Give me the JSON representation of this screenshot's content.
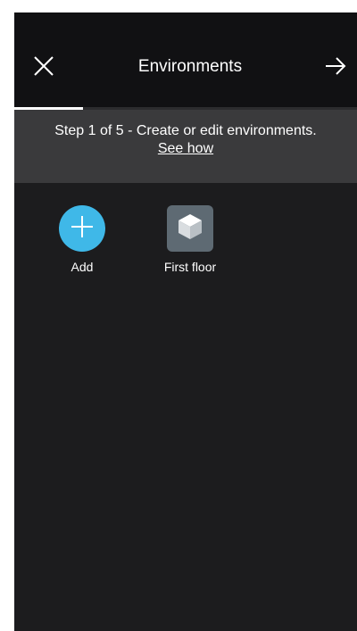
{
  "header": {
    "title": "Environments",
    "close_icon": "close-icon",
    "next_icon": "arrow-right-icon"
  },
  "progress": {
    "current_step": 1,
    "total_steps": 5,
    "fraction": 0.2
  },
  "banner": {
    "text": "Step 1 of 5 - Create or edit environments.",
    "link_label": "See how"
  },
  "environments": {
    "add": {
      "label": "Add",
      "icon": "plus-icon",
      "color": "#3fb8e8"
    },
    "items": [
      {
        "label": "First floor",
        "icon": "cube-icon",
        "color": "#5e6a73"
      }
    ]
  },
  "colors": {
    "background": "#1c1c1e",
    "header": "#111113",
    "banner": "#3a3a3c",
    "accent": "#3fb8e8"
  }
}
